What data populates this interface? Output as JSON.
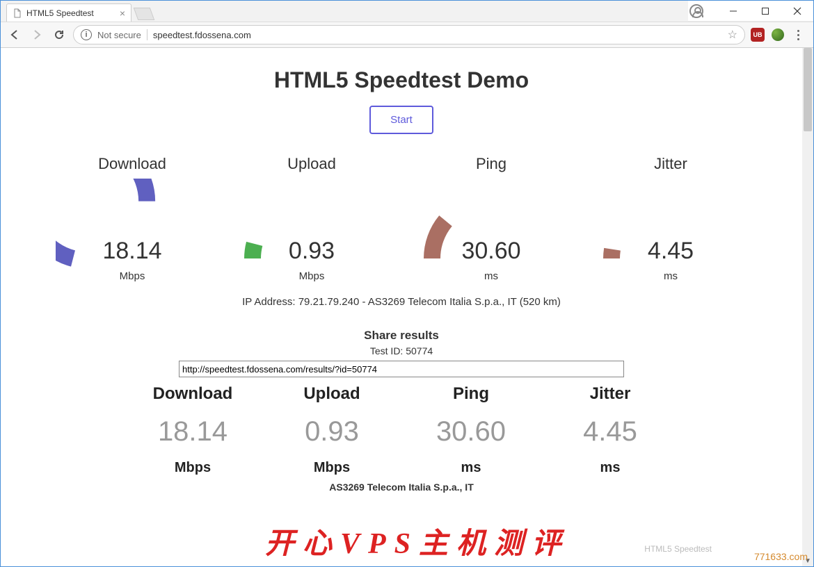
{
  "window": {
    "tab_title": "HTML5 Speedtest",
    "not_secure": "Not secure",
    "address_display": "speedtest.fdossena.com"
  },
  "ext": {
    "ub": "UB"
  },
  "page": {
    "title": "HTML5 Speedtest Demo",
    "start_label": "Start",
    "ip_line": "IP Address: 79.21.79.240 - AS3269 Telecom Italia S.p.a., IT (520 km)",
    "share": {
      "header": "Share results",
      "test_id_line": "Test ID: 50774",
      "url": "http://speedtest.fdossena.com/results/?id=50774"
    },
    "bottom_isp": "AS3269 Telecom Italia S.p.a., IT",
    "bottom_brand": "HTML5 Speedtest"
  },
  "metrics": {
    "download": {
      "label": "Download",
      "value": "18.14",
      "unit": "Mbps",
      "fill": 0.58,
      "color": "#6060C0"
    },
    "upload": {
      "label": "Upload",
      "value": "0.93",
      "unit": "Mbps",
      "fill": 0.08,
      "color": "#4CAF50"
    },
    "ping": {
      "label": "Ping",
      "value": "30.60",
      "unit": "ms",
      "fill": 0.22,
      "color": "#aa6f63"
    },
    "jitter": {
      "label": "Jitter",
      "value": "4.45",
      "unit": "ms",
      "fill": 0.05,
      "color": "#aa6f63"
    }
  },
  "results_card": {
    "cols": [
      {
        "label": "Download",
        "value": "18.14",
        "unit": "Mbps"
      },
      {
        "label": "Upload",
        "value": "0.93",
        "unit": "Mbps"
      },
      {
        "label": "Ping",
        "value": "30.60",
        "unit": "ms"
      },
      {
        "label": "Jitter",
        "value": "4.45",
        "unit": "ms"
      }
    ]
  },
  "watermark": {
    "text": "开心VPS主机测评",
    "link": "771633.com"
  }
}
